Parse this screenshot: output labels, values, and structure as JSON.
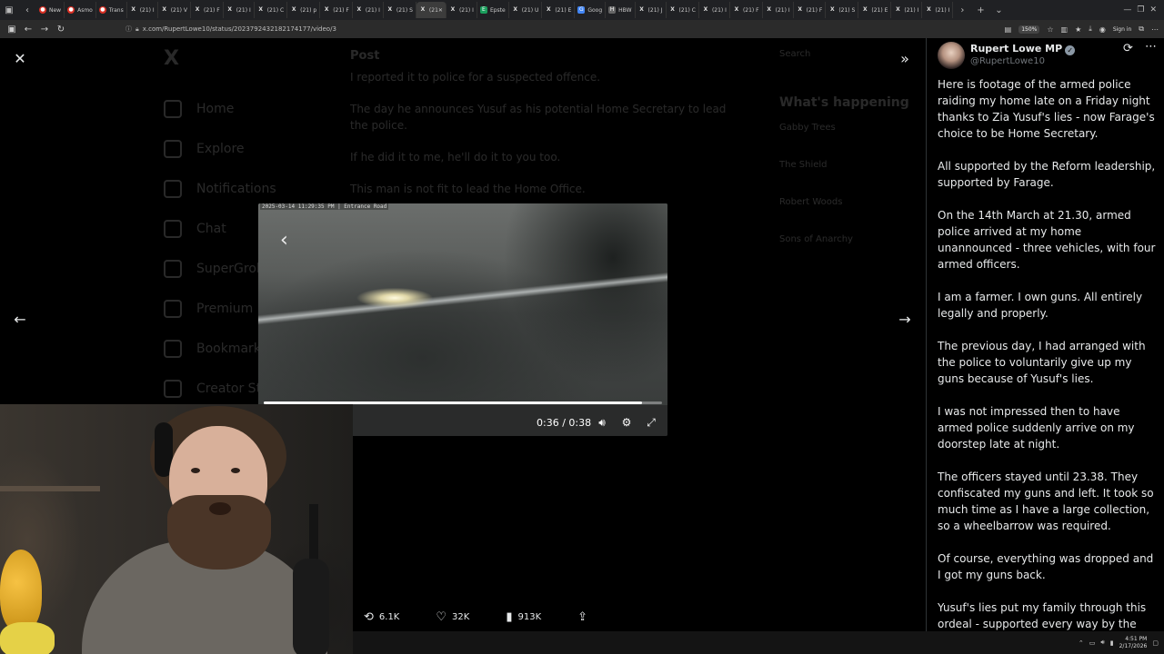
{
  "browser": {
    "tabs": [
      {
        "label": "New",
        "fav": "red",
        "favText": "●"
      },
      {
        "label": "Asmo",
        "fav": "red",
        "favText": "●"
      },
      {
        "label": "Trans",
        "fav": "red",
        "favText": "●"
      },
      {
        "label": "(21) I",
        "fav": "x",
        "favText": "X"
      },
      {
        "label": "(21) V",
        "fav": "x",
        "favText": "X"
      },
      {
        "label": "(21) F",
        "fav": "x",
        "favText": "X"
      },
      {
        "label": "(21) I",
        "fav": "x",
        "favText": "X"
      },
      {
        "label": "(21) C",
        "fav": "x",
        "favText": "X"
      },
      {
        "label": "(21) p",
        "fav": "x",
        "favText": "X"
      },
      {
        "label": "(21) F",
        "fav": "x",
        "favText": "X"
      },
      {
        "label": "(21) I",
        "fav": "x",
        "favText": "X"
      },
      {
        "label": "(21) S",
        "fav": "x",
        "favText": "X"
      },
      {
        "label": "(21",
        "fav": "x",
        "favText": "X",
        "active": true
      },
      {
        "label": "(21) I",
        "fav": "x",
        "favText": "X"
      },
      {
        "label": "Epste",
        "fav": "green",
        "favText": "E"
      },
      {
        "label": "(21) U",
        "fav": "x",
        "favText": "X"
      },
      {
        "label": "(21) E",
        "fav": "x",
        "favText": "X"
      },
      {
        "label": "Goog",
        "fav": "blue",
        "favText": "G"
      },
      {
        "label": "HBW",
        "fav": "grey",
        "favText": "H"
      },
      {
        "label": "(21) J",
        "fav": "x",
        "favText": "X"
      },
      {
        "label": "(21) C",
        "fav": "x",
        "favText": "X"
      },
      {
        "label": "(21) I",
        "fav": "x",
        "favText": "X"
      },
      {
        "label": "(21) F",
        "fav": "x",
        "favText": "X"
      },
      {
        "label": "(21) I",
        "fav": "x",
        "favText": "X"
      },
      {
        "label": "(21) F",
        "fav": "x",
        "favText": "X"
      },
      {
        "label": "(21) S",
        "fav": "x",
        "favText": "X"
      },
      {
        "label": "(21) E",
        "fav": "x",
        "favText": "X"
      },
      {
        "label": "(21) I",
        "fav": "x",
        "favText": "X"
      },
      {
        "label": "(21) I",
        "fav": "x",
        "favText": "X"
      }
    ],
    "new_tab": "+",
    "url": "x.com/RupertLowe10/status/2023792432182174177/video/3",
    "zoom": "150%",
    "sign_in": "Sign in"
  },
  "background_page": {
    "logo": "X",
    "header": "Post",
    "nav": [
      "Home",
      "Explore",
      "Notifications",
      "Chat",
      "SuperGrok",
      "Premium",
      "Bookmarks",
      "Creator Studio"
    ],
    "post_lines": [
      "I reported it to police for a suspected offence.",
      "The day he announces Yusuf as his potential Home Secretary to lead the police.",
      "If he did it to me, he'll do it to you too.",
      "This man is not fit to lead the Home Office."
    ],
    "search": "Search",
    "whats_happening": "What's happening",
    "trends": [
      "Gabby Trees",
      "The Shield",
      "Robert Woods",
      "Sons of Anarchy"
    ]
  },
  "video": {
    "caption": "2025-03-14 11:29:35 PM | Entrance Road",
    "time": "0:36 / 0:38",
    "progress": 0.95
  },
  "stats": {
    "retweets": "6.1K",
    "likes": "32K",
    "views": "913K"
  },
  "tweet": {
    "name": "Rupert Lowe MP",
    "handle": "@RupertLowe10",
    "paragraphs": [
      "Here is footage of the armed police raiding my home late on a Friday night thanks to Zia Yusuf's lies - now Farage's choice to be Home Secretary.",
      "All supported by the Reform leadership, supported by Farage.",
      "On the 14th March at 21.30, armed police arrived at my home unannounced - three vehicles, with four armed officers.",
      "I am a farmer. I own guns. All entirely legally and properly.",
      "The previous day, I had arranged with the police to voluntarily give up my guns because of Yusuf's lies.",
      "I was not impressed then to have armed police suddenly arrive on my doorstep late at night.",
      "The officers stayed until 23.38. They confiscated my guns and left. It took so much time as I have a large collection, so a wheelbarrow was required.",
      "Of course, everything was dropped and I got my guns back.",
      "Yusuf's lies put my family through this ordeal - supported every way by the"
    ]
  },
  "taskbar": {
    "time": "4:51 PM",
    "date": "2/17/2026"
  }
}
